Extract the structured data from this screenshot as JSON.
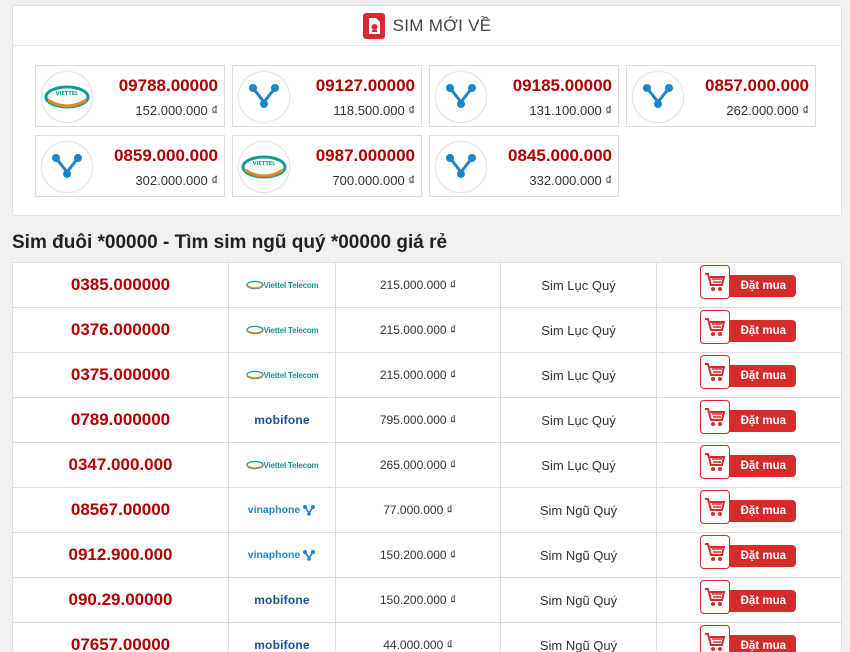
{
  "header": {
    "title": "SIM MỚI VỀ",
    "icon": "sim-card-icon"
  },
  "new_sims": [
    {
      "number": "09788.00000",
      "price": "152.000.000 ₫",
      "network": "viettel"
    },
    {
      "number": "09127.00000",
      "price": "118.500.000 ₫",
      "network": "vinaphone"
    },
    {
      "number": "09185.00000",
      "price": "131.100.000 ₫",
      "network": "vinaphone"
    },
    {
      "number": "0857.000.000",
      "price": "262.000.000 ₫",
      "network": "vinaphone"
    },
    {
      "number": "0859.000.000",
      "price": "302.000.000 ₫",
      "network": "vinaphone"
    },
    {
      "number": "0987.000000",
      "price": "700.000.000 ₫",
      "network": "viettel"
    },
    {
      "number": "0845.000.000",
      "price": "332.000.000 ₫",
      "network": "vinaphone"
    }
  ],
  "section": {
    "title": "Sim đuôi *00000 - Tìm sim ngũ quý *00000 giá rẻ"
  },
  "buy_label": "Đặt mua",
  "network_labels": {
    "viettel": "Viettel Telecom",
    "mobifone": "mobifone",
    "vinaphone": "vinaphone"
  },
  "rows": [
    {
      "number": "0385.000000",
      "network": "viettel",
      "price": "215.000.000 ₫",
      "type": "Sim Lục Quý"
    },
    {
      "number": "0376.000000",
      "network": "viettel",
      "price": "215.000.000 ₫",
      "type": "Sim Lục Quý"
    },
    {
      "number": "0375.000000",
      "network": "viettel",
      "price": "215.000.000 ₫",
      "type": "Sim Lục Quý"
    },
    {
      "number": "0789.000000",
      "network": "mobifone",
      "price": "795.000.000 ₫",
      "type": "Sim Lục Quý"
    },
    {
      "number": "0347.000.000",
      "network": "viettel",
      "price": "265.000.000 ₫",
      "type": "Sim Lục Quý"
    },
    {
      "number": "08567.00000",
      "network": "vinaphone",
      "price": "77.000.000 ₫",
      "type": "Sim Ngũ Quý"
    },
    {
      "number": "0912.900.000",
      "network": "vinaphone",
      "price": "150.200.000 ₫",
      "type": "Sim Ngũ Quý"
    },
    {
      "number": "090.29.00000",
      "network": "mobifone",
      "price": "150.200.000 ₫",
      "type": "Sim Ngũ Quý"
    },
    {
      "number": "07657.00000",
      "network": "mobifone",
      "price": "44.000.000 ₫",
      "type": "Sim Ngũ Quý"
    }
  ],
  "colors": {
    "accent": "#b00000",
    "button": "#d62b2b",
    "viettel": "#139a90",
    "mobifone": "#1a4f9c",
    "vinaphone": "#1a86c8"
  }
}
